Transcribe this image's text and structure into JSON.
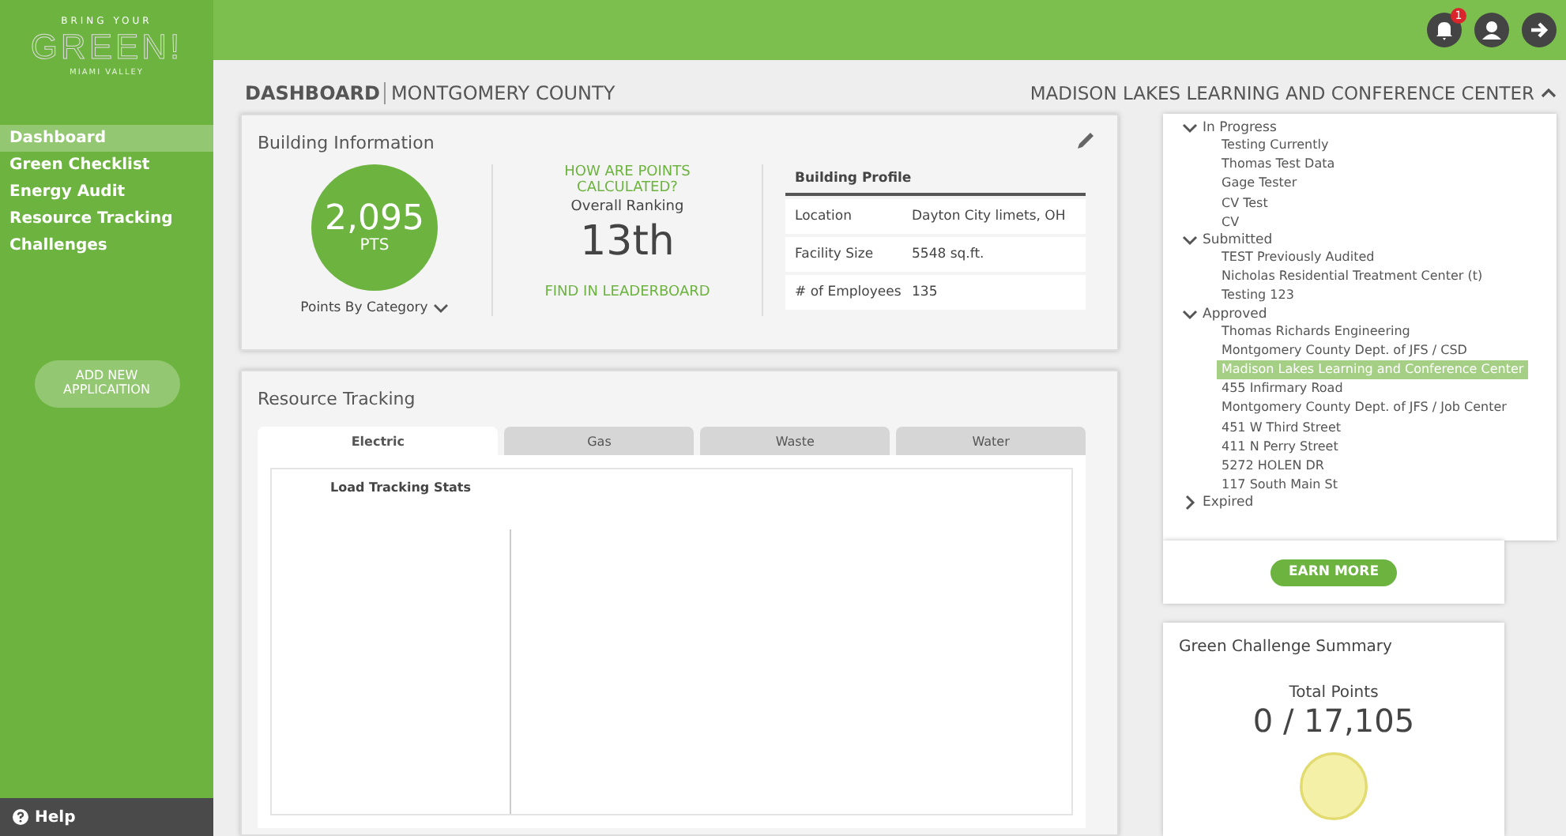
{
  "logo": {
    "tagline": "BRING YOUR",
    "name": "GREEN!",
    "region": "MIAMI VALLEY"
  },
  "sidebar": {
    "items": [
      {
        "label": "Dashboard",
        "selected": true
      },
      {
        "label": "Green Checklist",
        "selected": false
      },
      {
        "label": "Energy Audit",
        "selected": false
      },
      {
        "label": "Resource Tracking",
        "selected": false
      },
      {
        "label": "Challenges",
        "selected": false
      }
    ],
    "add_button": "ADD NEW APPLICAITION",
    "help": "Help"
  },
  "topbar": {
    "notification_count": "1"
  },
  "header": {
    "section": "DASHBOARD",
    "county": "MONTGOMERY COUNTY",
    "building": "MADISON LAKES LEARNING AND CONFERENCE CENTER",
    "expanded": true
  },
  "building_info": {
    "title": "Building Information",
    "points": "2,095",
    "points_unit": "PTS",
    "points_by_category": "Points By Category",
    "how_link": "HOW ARE POINTS CALCULATED?",
    "ranking_label": "Overall Ranking",
    "ranking": "13th",
    "leaderboard_link": "FIND IN LEADERBOARD",
    "profile": {
      "title": "Building Profile",
      "rows": [
        {
          "label": "Location",
          "value": "Dayton City limets, OH"
        },
        {
          "label": "Facility Size",
          "value": "5548 sq.ft."
        },
        {
          "label": "# of Employees",
          "value": "135"
        }
      ]
    }
  },
  "resource_tracking": {
    "title": "Resource Tracking",
    "tabs": [
      {
        "label": "Electric",
        "selected": true
      },
      {
        "label": "Gas",
        "selected": false
      },
      {
        "label": "Waste",
        "selected": false
      },
      {
        "label": "Water",
        "selected": false
      }
    ],
    "chart_title": "Load Tracking Stats"
  },
  "building_tree": [
    {
      "label": "In Progress",
      "expanded": true,
      "children": [
        {
          "label": "Testing Currently",
          "selected": false
        },
        {
          "label": "Thomas Test Data",
          "selected": false
        },
        {
          "label": "Gage Tester",
          "selected": false
        },
        {
          "label": "CV Test",
          "selected": false
        },
        {
          "label": "CV",
          "selected": false
        }
      ]
    },
    {
      "label": "Submitted",
      "expanded": true,
      "children": [
        {
          "label": "TEST Previously Audited",
          "selected": false
        },
        {
          "label": "Nicholas Residential Treatment Center (t)",
          "selected": false
        },
        {
          "label": "Testing 123",
          "selected": false
        }
      ]
    },
    {
      "label": "Approved",
      "expanded": true,
      "children": [
        {
          "label": "Thomas Richards Engineering",
          "selected": false
        },
        {
          "label": "Montgomery County Dept. of JFS / CSD",
          "selected": false
        },
        {
          "label": "Madison Lakes Learning and Conference Center",
          "selected": true
        },
        {
          "label": "455 Infirmary Road",
          "selected": false
        },
        {
          "label": "Montgomery County Dept. of JFS / Job Center",
          "selected": false
        },
        {
          "label": "451 W Third Street",
          "selected": false
        },
        {
          "label": "411 N Perry Street",
          "selected": false
        },
        {
          "label": "5272 HOLEN DR",
          "selected": false
        },
        {
          "label": "117 South Main St",
          "selected": false
        }
      ]
    },
    {
      "label": "Expired",
      "expanded": false
    }
  ],
  "earn_more": "EARN MORE",
  "challenge_summary": {
    "title": "Green Challenge Summary",
    "total_label": "Total Points",
    "total": "0 / 17,105"
  }
}
